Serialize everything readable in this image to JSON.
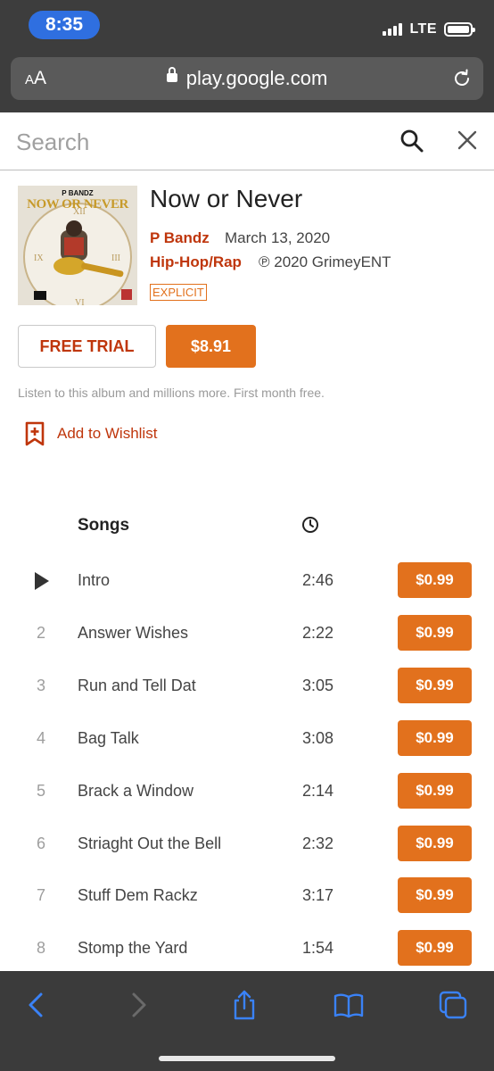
{
  "status_bar": {
    "time": "8:35",
    "network": "LTE"
  },
  "browser": {
    "text_size_label_small": "A",
    "text_size_label_large": "A",
    "url": "play.google.com"
  },
  "search": {
    "placeholder": "Search",
    "value": ""
  },
  "album": {
    "title": "Now or Never",
    "artist": "P Bandz",
    "release_date": "March 13, 2020",
    "genre": "Hip-Hop/Rap",
    "copyright": "℗ 2020 GrimeyENT",
    "explicit_label": "EXPLICIT",
    "cover_text": {
      "artist": "P BANDZ",
      "title": "NOW OR NEVER"
    }
  },
  "actions": {
    "free_trial_label": "FREE TRIAL",
    "buy_label": "$8.91",
    "promo_text": "Listen to this album and millions more. First month free.",
    "wishlist_label": "Add to Wishlist"
  },
  "songs": {
    "header": "Songs",
    "tracks": [
      {
        "num": "1",
        "title": "Intro",
        "duration": "2:46",
        "price": "$0.99"
      },
      {
        "num": "2",
        "title": "Answer Wishes",
        "duration": "2:22",
        "price": "$0.99"
      },
      {
        "num": "3",
        "title": "Run and Tell Dat",
        "duration": "3:05",
        "price": "$0.99"
      },
      {
        "num": "4",
        "title": "Bag Talk",
        "duration": "3:08",
        "price": "$0.99"
      },
      {
        "num": "5",
        "title": "Brack a Window",
        "duration": "2:14",
        "price": "$0.99"
      },
      {
        "num": "6",
        "title": "Striaght Out the Bell",
        "duration": "2:32",
        "price": "$0.99"
      },
      {
        "num": "7",
        "title": "Stuff Dem Rackz",
        "duration": "3:17",
        "price": "$0.99"
      },
      {
        "num": "8",
        "title": "Stomp the Yard",
        "duration": "1:54",
        "price": "$0.99"
      }
    ]
  },
  "colors": {
    "accent": "#e2711d",
    "link": "#bf360c",
    "chrome": "#3d3d3d",
    "ios_blue": "#2f6fe0"
  }
}
